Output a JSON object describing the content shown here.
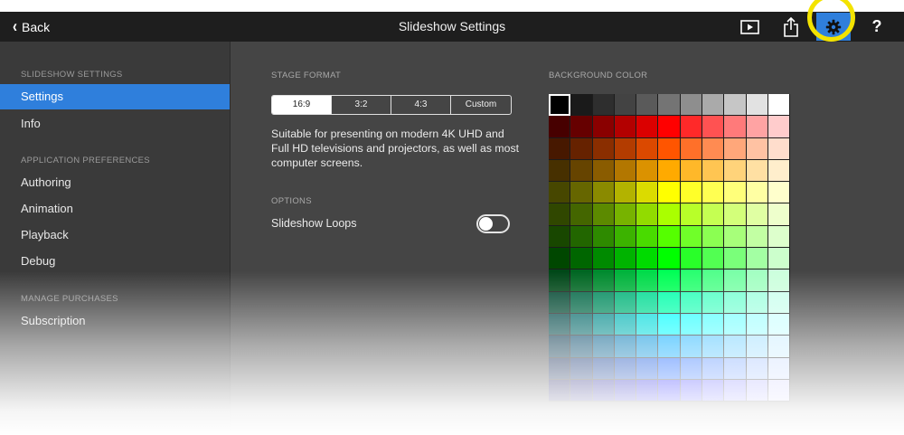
{
  "header": {
    "back_label": "Back",
    "title": "Slideshow Settings",
    "icons": [
      "play-icon",
      "share-icon",
      "gear-icon",
      "help-icon"
    ],
    "help_label": "?"
  },
  "sidebar": {
    "sections": [
      {
        "header": "SLIDESHOW SETTINGS",
        "items": [
          "Settings",
          "Info"
        ]
      },
      {
        "header": "APPLICATION PREFERENCES",
        "items": [
          "Authoring",
          "Animation",
          "Playback",
          "Debug"
        ]
      },
      {
        "header": "MANAGE PURCHASES",
        "items": [
          "Subscription"
        ]
      }
    ],
    "selected": "Settings"
  },
  "stage": {
    "header": "STAGE FORMAT",
    "options": [
      "16:9",
      "3:2",
      "4:3",
      "Custom"
    ],
    "selected": "16:9",
    "description": "Suitable for presenting on modern 4K UHD and Full HD televisions and projectors, as well as most computer screens."
  },
  "options": {
    "header": "OPTIONS",
    "loop_label": "Slideshow Loops",
    "loop_enabled": false
  },
  "background": {
    "header": "BACKGROUND COLOR",
    "selected": "#000000"
  },
  "colors": {
    "accent": "#2f7fdc",
    "highlight_ring": "#f3e300"
  }
}
